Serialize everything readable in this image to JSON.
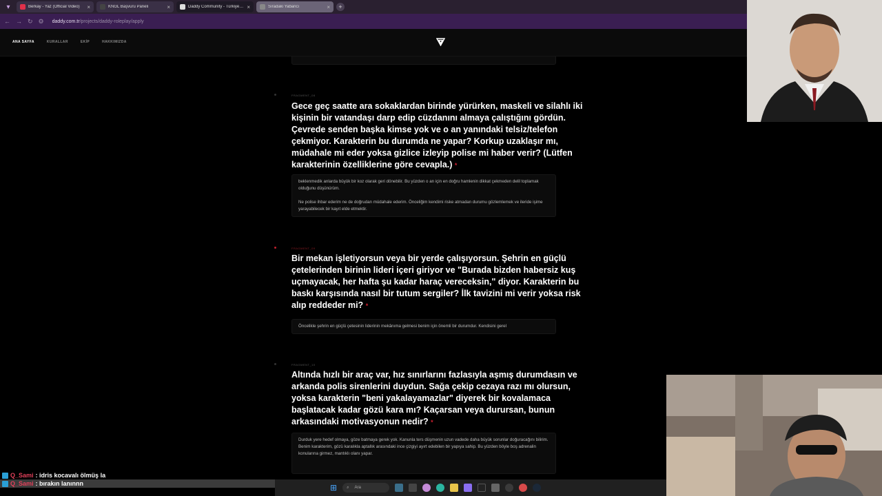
{
  "browser": {
    "tabs": [
      {
        "title": "Berkay - Yaz (Official Video)",
        "favicon_color": "#e0304a",
        "active": false
      },
      {
        "title": "KNGL Başvuru Paneli",
        "favicon_color": "#444444",
        "active": false
      },
      {
        "title": "Daddy Community - Türkiye'nin",
        "favicon_color": "#dddddd",
        "active": true
      },
      {
        "title": "Sıradaki Yabancı",
        "favicon_color": "#888888",
        "active": false
      }
    ],
    "url_host": "daddy.com.tr",
    "url_path": "/projects/daddy-roleplay/apply"
  },
  "site_nav": {
    "links": [
      "ANA SAYFA",
      "KURALLAR",
      "EKİP",
      "HAKKIMIZDA"
    ]
  },
  "questions": [
    {
      "fragment": "FRAGMENT_08",
      "title": "Gece geç saatte ara sokaklardan birinde yürürken, maskeli ve silahlı iki kişinin bir vatandaşı darp edip cüzdanını almaya çalıştığını gördün. Çevrede senden başka kimse yok ve o an yanındaki telsiz/telefon çekmiyor. Karakterin bu durumda ne yapar? Korkup uzaklaşır mı, müdahale mi eder yoksa gizlice izleyip polise mi haber verir? (Lütfen karakterinin özelliklerine göre cevapla.)",
      "answer_p1": "beklenmedik anlarda büyük bir koz olarak geri dönebilir. Bu yüzden o an için en doğru hamlenin dikkat çekmeden delil toplamak olduğunu düşünürüm.",
      "answer_p2": "Ne polise ihbar ederim ne de doğrudan müdahale ederim. Önceliğim kendimi riske atmadan durumu gözlemlemek ve ileride işime yarayabilecek bir kayıt elde etmektir."
    },
    {
      "fragment": "FRAGMENT_09",
      "title": "Bir mekan işletiyorsun veya bir yerde çalışıyorsun. Şehrin en güçlü çetelerinden birinin lideri içeri giriyor ve \"Burada bizden habersiz kuş uçmayacak, her hafta şu kadar haraç vereceksin,\" diyor. Karakterin bu baskı karşısında nasıl bir tutum sergiler? İlk tavizini mi verir yoksa risk alıp reddeder mi?",
      "answer_p1": "Öncelikle şehrin en güçlü çetesinin liderinin mekânıma gelmesi benim için önemli bir durumdur. Kendisini gerel"
    },
    {
      "fragment": "FRAGMENT_10",
      "title": "Altında hızlı bir araç var, hız sınırlarını fazlasıyla aşmış durumdasın ve arkanda polis sirenlerini duydun. Sağa çekip cezaya razı mı olursun, yoksa karakterin \"beni yakalayamazlar\" diyerek bir kovalamaca başlatacak kadar gözü kara mı? Kaçarsan veya durursan, bunun arkasındaki motivasyonun nedir?",
      "answer_p1": "Durduk yere hedef olmaya, göze batmaya gerek yok. Kanunla ters düşmenin uzun vadede daha büyük sorunlar doğuracağını bilirim. Benim karakterim, gözü karalıkla aptallık arasındaki ince çizgiyi ayırt edebilen bir yapıya sahip. Bu yüzden böyle boş adrenalin konularına girmez, mantıklı olanı yapar."
    }
  ],
  "required_mark": "*",
  "chat": [
    {
      "user": "Q_Sami",
      "message": ": idris kocavalı ölmüş la"
    },
    {
      "user": "Q_Sami",
      "message": ": bırakın lanınnn"
    }
  ],
  "taskbar": {
    "search_label": "Ara"
  },
  "colors": {
    "accent_red": "#d02030",
    "browser_chrome": "#3a1e52"
  }
}
